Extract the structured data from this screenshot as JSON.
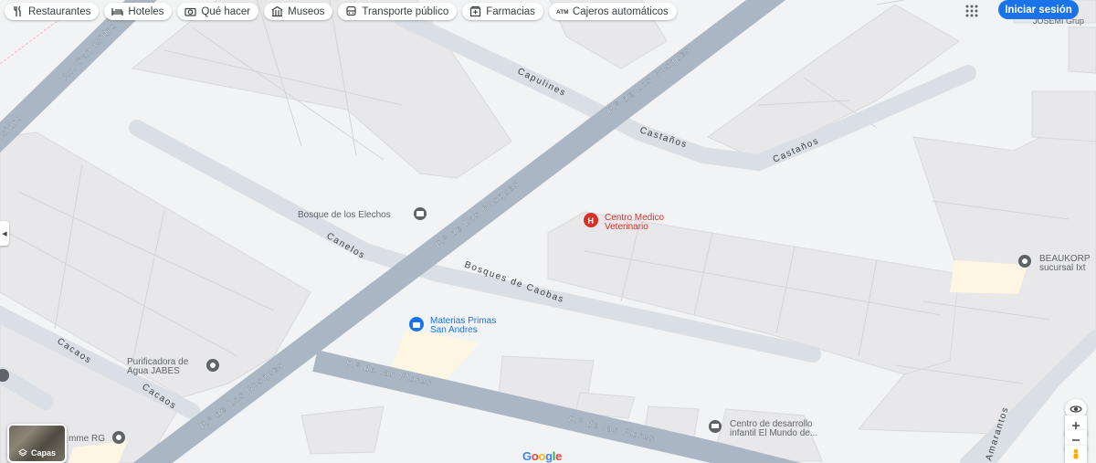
{
  "chips": [
    {
      "label": "Restaurantes",
      "icon": "restaurant-icon"
    },
    {
      "label": "Hoteles",
      "icon": "hotel-bed-icon"
    },
    {
      "label": "Qué hacer",
      "icon": "camera-icon"
    },
    {
      "label": "Museos",
      "icon": "museum-icon"
    },
    {
      "label": "Transporte público",
      "icon": "bus-icon"
    },
    {
      "label": "Farmacias",
      "icon": "pharmacy-icon"
    },
    {
      "label": "Cajeros automáticos",
      "icon": "atm-icon"
    }
  ],
  "header": {
    "signin_label": "Iniciar sesión",
    "apps_icon": "apps-grid-icon"
  },
  "streets": {
    "av_san_isidro": "Av. San Isidro",
    "isidro_fragment": "Isidro",
    "capulines": "Capulines",
    "castanos": "Castaños",
    "paseo_los_bosques": "P.º de Los Bosques",
    "canelos": "Canelos",
    "bosques_de_caobas": "Bosques de Caobas",
    "paseo_las_flores": "P.º de las Flores",
    "cacaos": "Cacaos",
    "amarantos": "Amarantos"
  },
  "places": {
    "bosque_elechos": "Bosque de los Elechos",
    "centro_medico_l1": "Centro Medico",
    "centro_medico_l2": "Veterinario",
    "materias_l1": "Materias Primas",
    "materias_l2": "San Andres",
    "purificadora_l1": "Purificadora de",
    "purificadora_l2": "Agua JABES",
    "centro_desarrollo_l1": "Centro de desarrollo",
    "centro_desarrollo_l2": "infantil El Mundo de...",
    "beaukorp_l1": "BEAUKORP",
    "beaukorp_l2": "sucursal Ixt",
    "josemi": "JOSEMI Grup",
    "mme_rg": "mme RG"
  },
  "controls": {
    "layers_label": "Capas"
  },
  "logo": {
    "text": "Google",
    "colors": [
      "#4285f4",
      "#ea4335",
      "#fbbc05",
      "#4285f4",
      "#34a853",
      "#ea4335"
    ]
  },
  "colors": {
    "road_major": "#aab6c3",
    "road_minor": "#dadfe6",
    "block": "#e8e8ea",
    "poi_grey": "#5f6368",
    "poi_red": "#d93025",
    "poi_blue": "#1a73e8",
    "accent": "#1a73e8"
  }
}
